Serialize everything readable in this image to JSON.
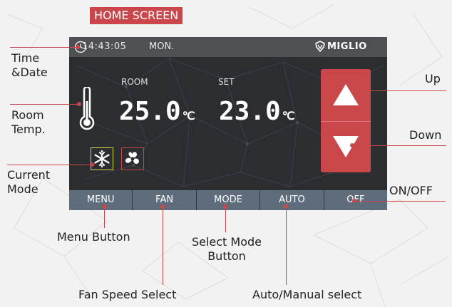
{
  "heading": "HOME SCREEN",
  "status_bar": {
    "time": "14:43:05",
    "day": "MON.",
    "brand": "MIGLIO"
  },
  "temperatures": {
    "room_label": "ROOM",
    "room_value": "25.0",
    "set_label": "SET",
    "set_value": "23.0",
    "unit": "℃"
  },
  "modes": [
    {
      "name": "cool",
      "icon": "snowflake-icon",
      "border_color": "#d8e04a"
    },
    {
      "name": "fan",
      "icon": "fan-icon",
      "border_color": "#c9474b"
    }
  ],
  "bottom_bar": {
    "menu": "MENU",
    "fan": "FAN",
    "mode": "MODE",
    "auto": "AUTO",
    "off": "OFF"
  },
  "callouts": {
    "time_date": [
      "Time",
      "&Date"
    ],
    "room_temp": [
      "Room",
      "Temp."
    ],
    "current_mode": [
      "Current",
      "Mode"
    ],
    "up": "Up",
    "down": "Down",
    "on_off": "ON/OFF",
    "menu_button": "Menu Button",
    "select_mode": [
      "Select Mode",
      "Button"
    ],
    "fan_speed": "Fan Speed Select",
    "auto_manual": "Auto/Manual select"
  },
  "colors": {
    "accent": "#c9474b",
    "screen_bg": "#2b2d31",
    "status_bar": "#4f5054",
    "bottom_bar": "#5e6c7c",
    "cool_mode": "#d8e04a"
  }
}
